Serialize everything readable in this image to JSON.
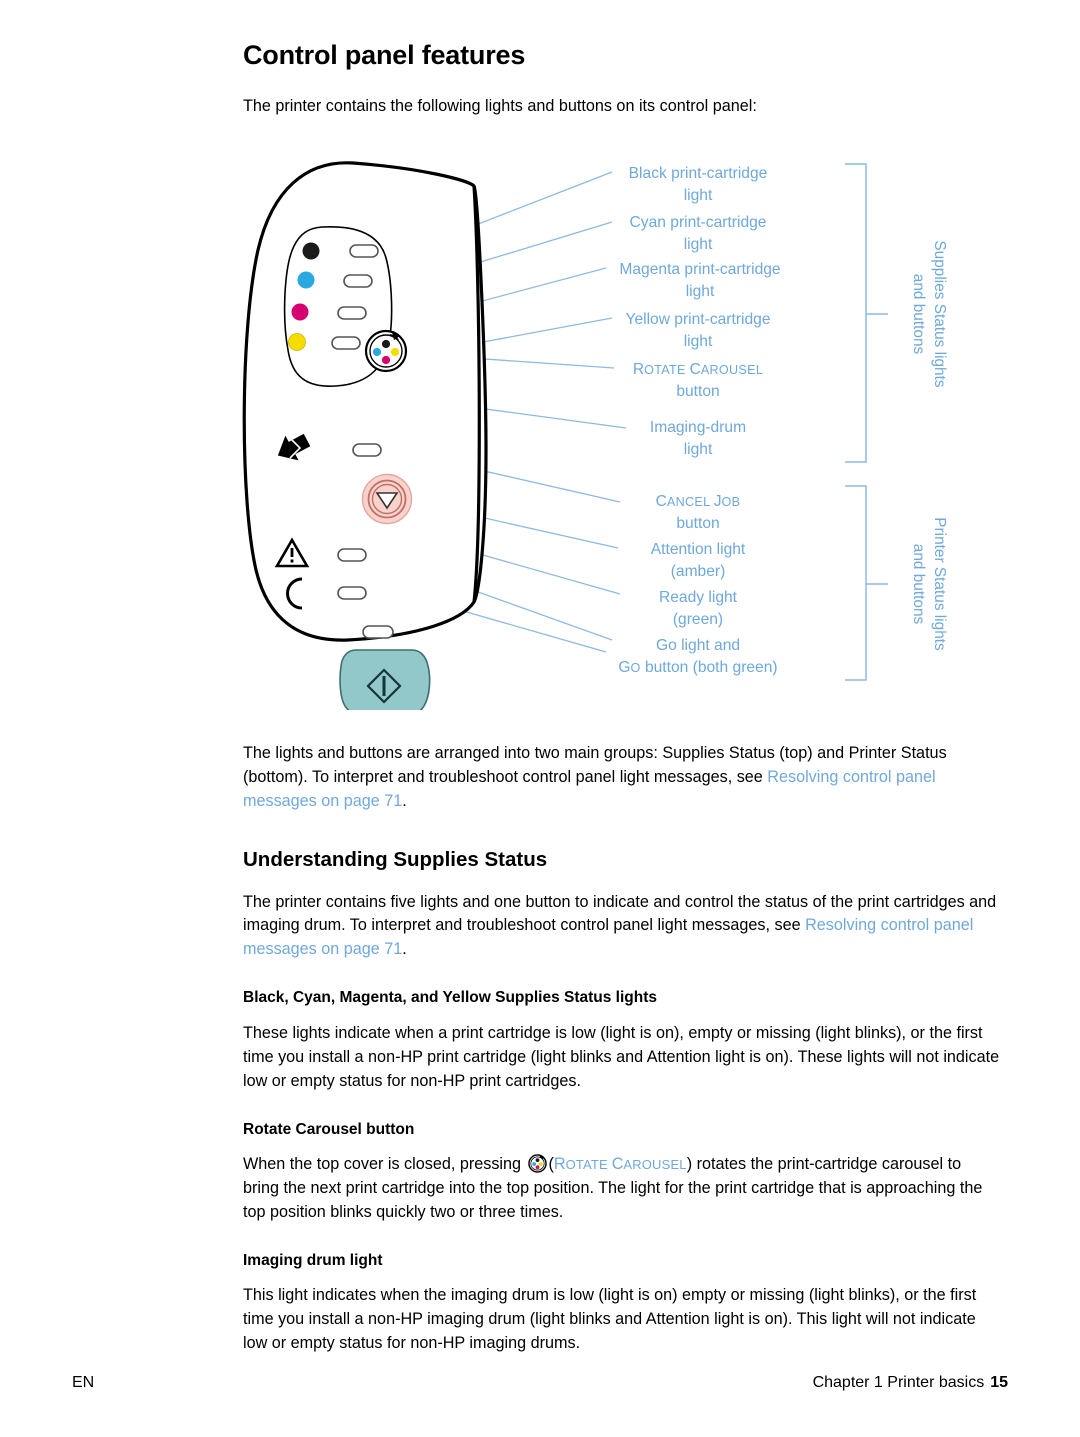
{
  "document": {
    "title": "Control panel features",
    "intro": "The printer contains the following lights and buttons on its control panel:"
  },
  "figure": {
    "callouts": [
      {
        "id": "black-light",
        "line1": "Black print-cartridge",
        "line2": "light"
      },
      {
        "id": "cyan-light",
        "line1": "Cyan print-cartridge",
        "line2": "light"
      },
      {
        "id": "magenta-light",
        "line1": "Magenta print-cartridge",
        "line2": "light"
      },
      {
        "id": "yellow-light",
        "line1": "Yellow print-cartridge",
        "line2": "light"
      },
      {
        "id": "rotate-carousel",
        "line1_sc_first": "R",
        "line1_sc_rest": "OTATE ",
        "line1_sc_first2": "C",
        "line1_sc_rest2": "AROUSEL",
        "line2": "button"
      },
      {
        "id": "imaging-drum",
        "line1": "Imaging-drum",
        "line2": "light"
      },
      {
        "id": "cancel-job",
        "line1_sc_first": "C",
        "line1_sc_rest": "ANCEL ",
        "line1_sc_first2": "J",
        "line1_sc_rest2": "OB",
        "line2": "button"
      },
      {
        "id": "attention-light",
        "line1": "Attention light",
        "line2": "(amber)"
      },
      {
        "id": "ready-light",
        "line1": "Ready light",
        "line2": "(green)"
      },
      {
        "id": "go-light",
        "line1": "Go light and",
        "line2_sc_first": "G",
        "line2_sc_rest": "O",
        "line2_tail": " button (both green)"
      }
    ],
    "groups": [
      {
        "id": "supplies-group",
        "line1": "Supplies Status lights",
        "line2": "and buttons"
      },
      {
        "id": "printer-group",
        "line1": "Printer Status lights",
        "line2": "and buttons"
      }
    ],
    "colors": {
      "callout_text": "#6FA8DC",
      "leader_line": "#8DB9E2",
      "panel_outline": "#000000",
      "black_dot": "#1A1A1A",
      "cyan_dot": "#29A9DF",
      "magenta_dot": "#D6006E",
      "yellow_dot": "#F5DD00",
      "cancel_button": "#F9D2CC",
      "go_button": "#92C8C9"
    }
  },
  "paragraphs": {
    "groups_intro_a": "The lights and buttons are arranged into two main groups: Supplies Status (top) and Printer Status (bottom). To interpret and troubleshoot control panel light messages, see ",
    "groups_intro_xref": "Resolving control panel messages  on page 71",
    "groups_intro_end": ".",
    "supplies_heading": "Understanding Supplies Status",
    "supplies_intro_a": "The printer contains five lights and one button to indicate and control the status of the print cartridges and imaging drum. To interpret and troubleshoot control panel light messages, see ",
    "supplies_intro_xref": "Resolving control panel messages  on page 71",
    "supplies_intro_end": ".",
    "lights_heading": "Black, Cyan, Magenta, and Yellow Supplies Status lights",
    "lights_body": "These lights indicate when a print cartridge is low (light is on), empty or missing (light blinks), or the first time you install a non-HP print cartridge (light blinks and Attention light is on). These lights will not indicate low or empty status for non-HP print cartridges.",
    "rotate_heading": "Rotate Carousel button",
    "rotate_body_a": "When the top cover is closed, pressing ",
    "rotate_body_open": "(",
    "rotate_sc_r": "R",
    "rotate_sc_otate": "OTATE ",
    "rotate_sc_c": "C",
    "rotate_sc_arousel": "AROUSEL",
    "rotate_body_close": ")",
    "rotate_body_b": " rotates the print-cartridge carousel to bring the next print cartridge into the top position. The light for the print cartridge that is approaching the top position blinks quickly two or three times.",
    "imaging_heading": "Imaging drum light",
    "imaging_body": "This light indicates when the imaging drum is low (light is on) empty or missing (light blinks), or the first time you install a non-HP imaging drum (light blinks and Attention light is on). This light will not indicate low or empty status for non-HP imaging drums."
  },
  "footer": {
    "language": "EN",
    "chapter": "Chapter 1 Printer basics",
    "page_number": "15"
  }
}
